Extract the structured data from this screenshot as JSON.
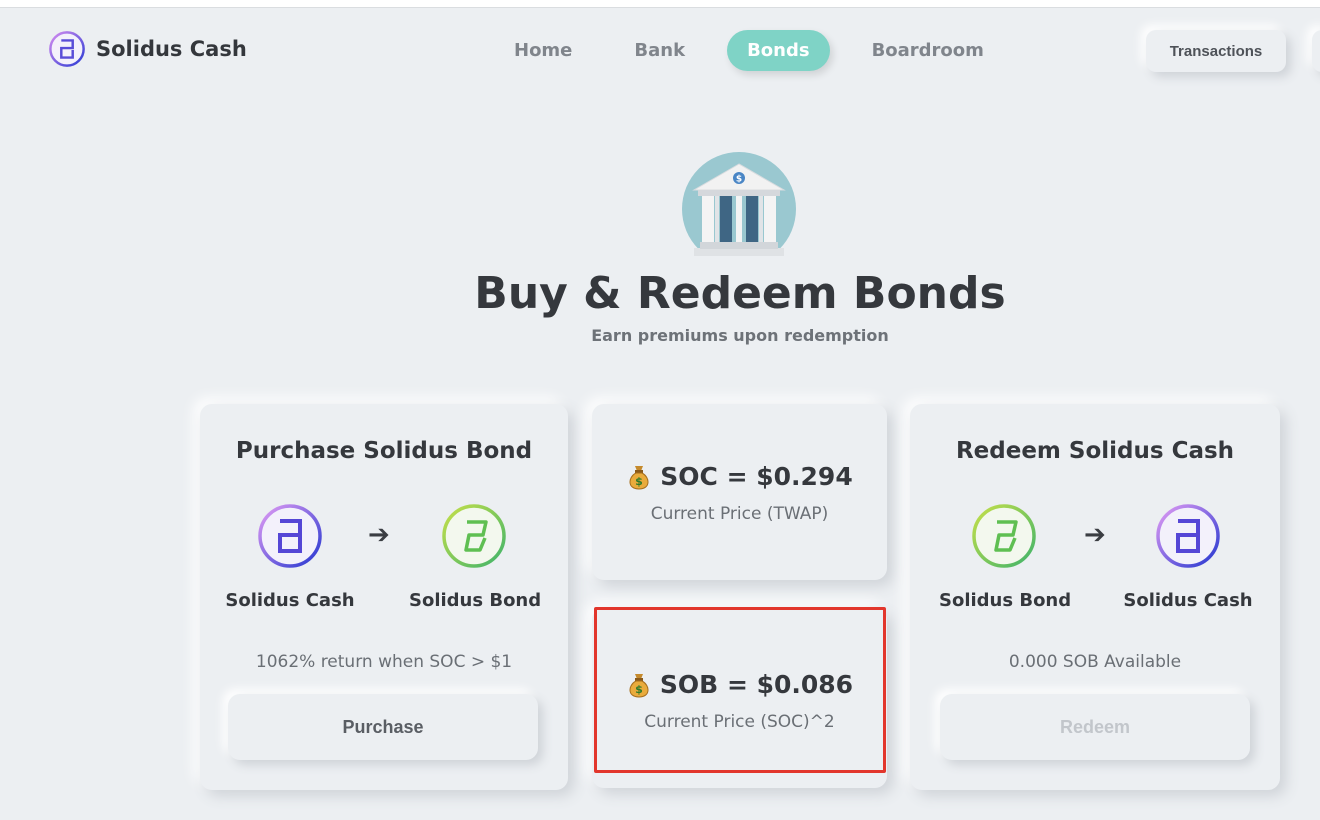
{
  "brand": {
    "name": "Solidus Cash"
  },
  "nav": {
    "items": [
      {
        "label": "Home",
        "active": false
      },
      {
        "label": "Bank",
        "active": false
      },
      {
        "label": "Bonds",
        "active": true
      },
      {
        "label": "Boardroom",
        "active": false
      }
    ],
    "transactions_label": "Transactions"
  },
  "hero": {
    "title": "Buy & Redeem Bonds",
    "subtitle": "Earn premiums upon redemption"
  },
  "purchase_card": {
    "title": "Purchase Solidus Bond",
    "from_token": "Solidus Cash",
    "to_token": "Solidus Bond",
    "note": "1062% return when SOC > $1",
    "button_label": "Purchase"
  },
  "soc_price": {
    "line": "SOC = $0.294",
    "sub": "Current Price (TWAP)"
  },
  "sob_price": {
    "line": "SOB = $0.086",
    "sub": "Current Price (SOC)^2"
  },
  "redeem_card": {
    "title": "Redeem Solidus Cash",
    "from_token": "Solidus Bond",
    "to_token": "Solidus Cash",
    "note": "0.000 SOB Available",
    "button_label": "Redeem"
  },
  "colors": {
    "accent": "#7fd3c6",
    "background": "#eceff2",
    "highlight": "#e2362c"
  },
  "icons": {
    "cash": "solidus-cash-icon",
    "bond": "solidus-bond-icon",
    "money_bag": "money-bag-icon",
    "bank": "bank-building-icon",
    "arrow": "arrow-right-icon"
  }
}
